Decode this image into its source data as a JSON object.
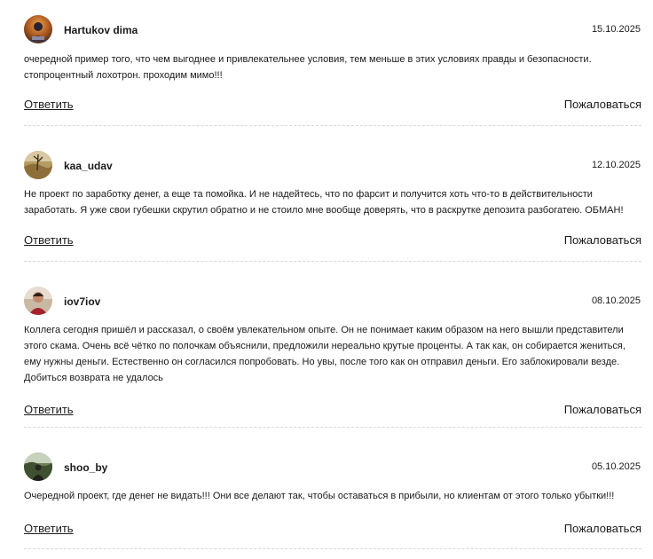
{
  "comments": [
    {
      "author": "Hartukov dima",
      "date": "15.10.2025",
      "lines": [
        "очередной пример того, что чем выгоднее и привлекательнее условия, тем меньше в этих условиях правды и безопасности.",
        "стопроцентный лохотрон. проходим мимо!!!"
      ],
      "reply_label": "Ответить",
      "report_label": "Пожаловаться"
    },
    {
      "author": "kaa_udav",
      "date": "12.10.2025",
      "lines": [
        "Не проект по заработку денег, а еще та помойка. И не надейтесь, что по фарсит и получится хоть что-то в действительности",
        "заработать. Я уже свои губешки скрутил обратно и не стоило мне вообще доверять, что в раскрутке депозита разбогатею. ОБМАН!"
      ],
      "reply_label": "Ответить",
      "report_label": "Пожаловаться"
    },
    {
      "author": "iov7iov",
      "date": "08.10.2025",
      "lines": [
        "Коллега сегодня пришёл и рассказал, о своём увлекательном опыте. Он не понимает каким образом на него вышли представители",
        "этого скама. Очень всё чётко по полочкам объяснили, предложили нереально крутые проценты. А так как, он собирается жениться,",
        "ему нужны деньги. Естественно он согласился попробовать. Но увы, после того как он отправил деньги. Его заблокировали везде.",
        "Добиться возврата не удалось"
      ],
      "reply_label": "Ответить",
      "report_label": "Пожаловаться"
    },
    {
      "author": "shoo_by",
      "date": "05.10.2025",
      "lines": [
        "Очередной проект, где денег не видать!!! Они все делают так, чтобы оставаться в прибыли, но клиентам от этого только убытки!!!"
      ],
      "reply_label": "Ответить",
      "report_label": "Пожаловаться"
    }
  ]
}
